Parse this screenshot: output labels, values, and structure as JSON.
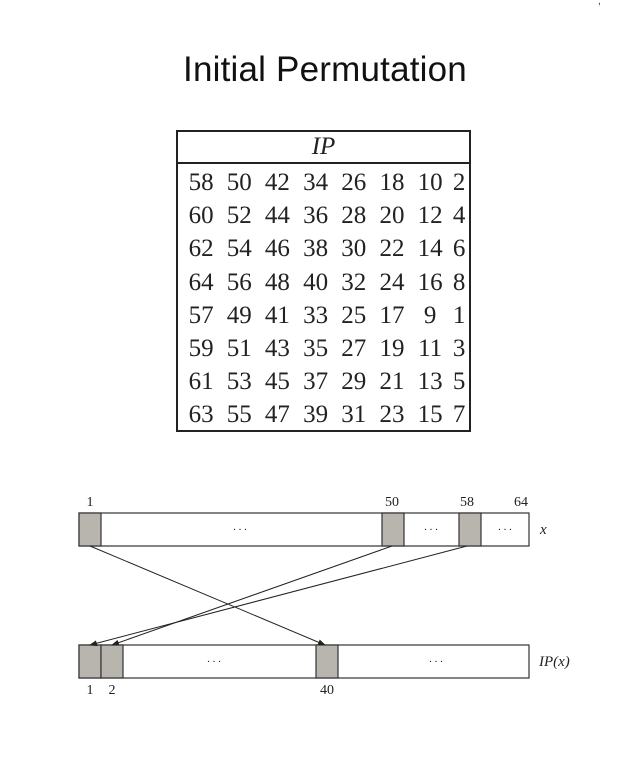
{
  "title": "Initial Permutation",
  "table": {
    "header": "IP",
    "rows": [
      [
        "58",
        "50",
        "42",
        "34",
        "26",
        "18",
        "10",
        "2"
      ],
      [
        "60",
        "52",
        "44",
        "36",
        "28",
        "20",
        "12",
        "4"
      ],
      [
        "62",
        "54",
        "46",
        "38",
        "30",
        "22",
        "14",
        "6"
      ],
      [
        "64",
        "56",
        "48",
        "40",
        "32",
        "24",
        "16",
        "8"
      ],
      [
        "57",
        "49",
        "41",
        "33",
        "25",
        "17",
        "9",
        "1"
      ],
      [
        "59",
        "51",
        "43",
        "35",
        "27",
        "19",
        "11",
        "3"
      ],
      [
        "61",
        "53",
        "45",
        "37",
        "29",
        "21",
        "13",
        "5"
      ],
      [
        "63",
        "55",
        "47",
        "39",
        "31",
        "23",
        "15",
        "7"
      ]
    ]
  },
  "diagram": {
    "top_positions": [
      "1",
      "50",
      "58",
      "64"
    ],
    "top_label": "x",
    "bottom_positions": [
      "1",
      "2",
      "40"
    ],
    "bottom_label": "IP(x)",
    "ellipsis": ". . .",
    "colors": {
      "highlight": "#b8b4ae",
      "line": "#222222"
    }
  }
}
